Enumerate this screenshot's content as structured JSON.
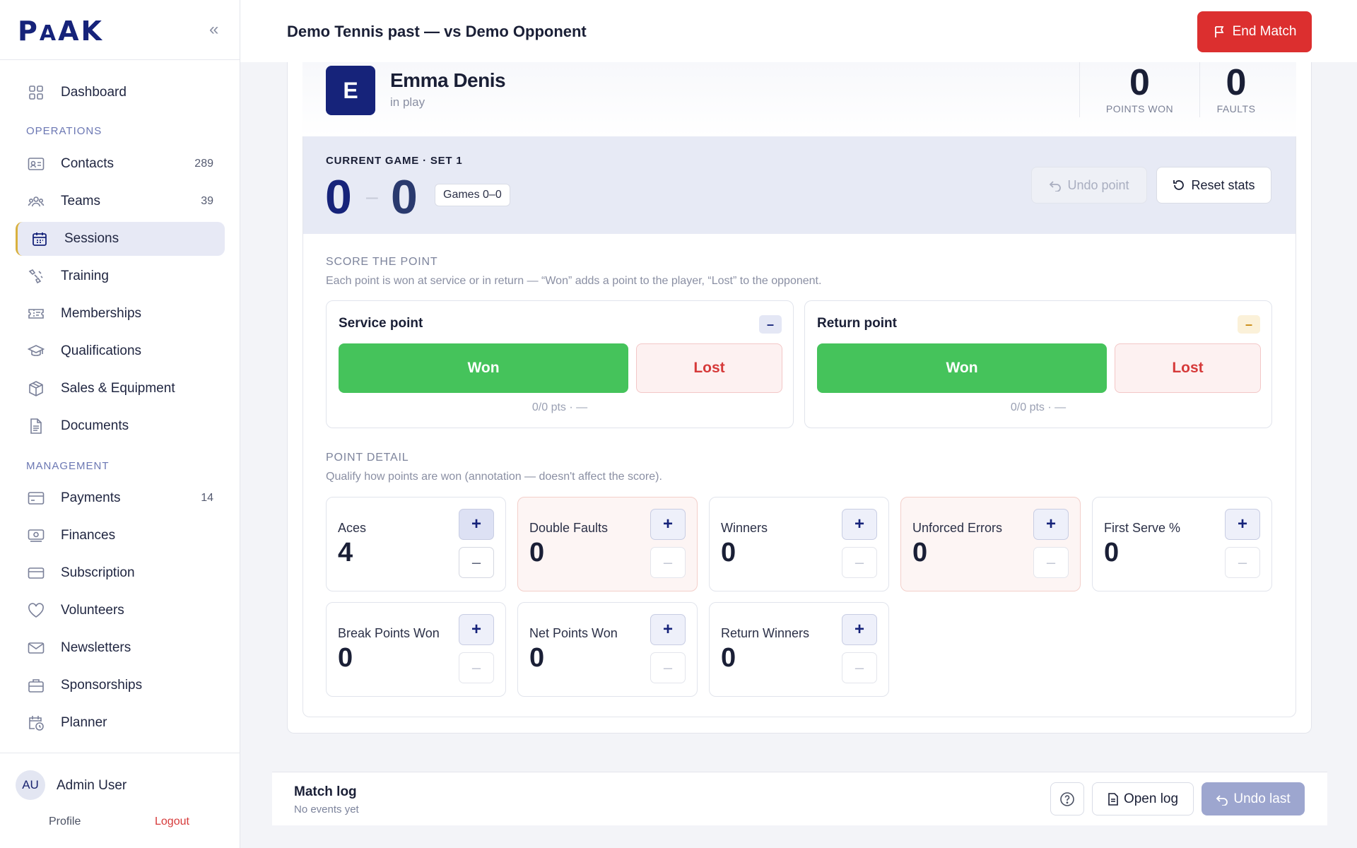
{
  "sidebar": {
    "logo": "PAAK",
    "collapse_icon": "chevron-double-left-icon",
    "items": [
      {
        "label": "Dashboard",
        "icon": "grid-icon",
        "count": ""
      },
      {
        "label": "Contacts",
        "icon": "contact-card-icon",
        "count": "289"
      },
      {
        "label": "Teams",
        "icon": "team-icon",
        "count": "39"
      },
      {
        "label": "Sessions",
        "icon": "calendar-icon",
        "count": "",
        "active": true
      },
      {
        "label": "Training",
        "icon": "training-icon",
        "count": ""
      },
      {
        "label": "Memberships",
        "icon": "ticket-icon",
        "count": ""
      },
      {
        "label": "Qualifications",
        "icon": "graduation-cap-icon",
        "count": ""
      },
      {
        "label": "Sales & Equipment",
        "icon": "box-icon",
        "count": ""
      },
      {
        "label": "Documents",
        "icon": "document-icon",
        "count": ""
      },
      {
        "label": "Payments",
        "icon": "credit-card-icon",
        "count": "14"
      },
      {
        "label": "Finances",
        "icon": "money-icon",
        "count": ""
      },
      {
        "label": "Subscription",
        "icon": "card-icon",
        "count": ""
      },
      {
        "label": "Volunteers",
        "icon": "heart-icon",
        "count": ""
      },
      {
        "label": "Newsletters",
        "icon": "mail-icon",
        "count": ""
      },
      {
        "label": "Sponsorships",
        "icon": "briefcase-icon",
        "count": ""
      },
      {
        "label": "Planner",
        "icon": "calendar-clock-icon",
        "count": ""
      }
    ],
    "sections": {
      "operations": "OPERATIONS",
      "management": "MANAGEMENT"
    },
    "user": {
      "initials": "AU",
      "name": "Admin User",
      "profile": "Profile",
      "logout": "Logout"
    }
  },
  "header": {
    "title": "Demo Tennis past — vs Demo Opponent",
    "end_match": "End Match"
  },
  "player": {
    "initial": "E",
    "name": "Emma Denis",
    "status": "in play",
    "points_won": "0",
    "points_won_label": "POINTS WON",
    "faults": "0",
    "faults_label": "FAULTS"
  },
  "current_game": {
    "label": "CURRENT GAME · SET 1",
    "player_score": "0",
    "separator": "–",
    "opponent_score": "0",
    "games": "Games 0–0",
    "undo_point": "Undo point",
    "reset_stats": "Reset stats"
  },
  "score_the_point": {
    "title": "SCORE THE POINT",
    "subtitle": "Each point is won at service or in return — “Won” adds a point to the player, “Lost” to the opponent.",
    "cards": [
      {
        "title": "Service point",
        "won": "Won",
        "lost": "Lost",
        "footer": "0/0 pts · —",
        "minus": "–",
        "minus_color": "#16237a",
        "minus_bg": "#e4e7f5"
      },
      {
        "title": "Return point",
        "won": "Won",
        "lost": "Lost",
        "footer": "0/0 pts · —",
        "minus": "–",
        "minus_color": "#c98a10",
        "minus_bg": "#fbf1d9"
      }
    ]
  },
  "point_detail": {
    "title": "POINT DETAIL",
    "subtitle": "Qualify how points are won (annotation — doesn't affect the score).",
    "stats": [
      {
        "label": "Aces",
        "value": "4",
        "plus": "+",
        "minus": "–"
      },
      {
        "label": "Double Faults",
        "value": "0",
        "plus": "+",
        "minus": "–"
      },
      {
        "label": "Winners",
        "value": "0",
        "plus": "+",
        "minus": "–"
      },
      {
        "label": "Unforced Errors",
        "value": "0",
        "plus": "+",
        "minus": "–"
      },
      {
        "label": "First Serve %",
        "value": "0",
        "plus": "+",
        "minus": "–"
      },
      {
        "label": "Break Points Won",
        "value": "0",
        "plus": "+",
        "minus": "–"
      },
      {
        "label": "Net Points Won",
        "value": "0",
        "plus": "+",
        "minus": "–"
      },
      {
        "label": "Return Winners",
        "value": "0",
        "plus": "+",
        "minus": "–"
      }
    ]
  },
  "match_log": {
    "title": "Match log",
    "subtitle": "No events yet",
    "help_icon": "help-circle-icon",
    "open_log": "Open log",
    "undo_last": "Undo last"
  },
  "colors": {
    "brand": "#16237a",
    "danger": "#dc2f2f",
    "won": "#45c35b",
    "lost_text": "#d63a3a",
    "active_accent": "#d9b13f"
  }
}
